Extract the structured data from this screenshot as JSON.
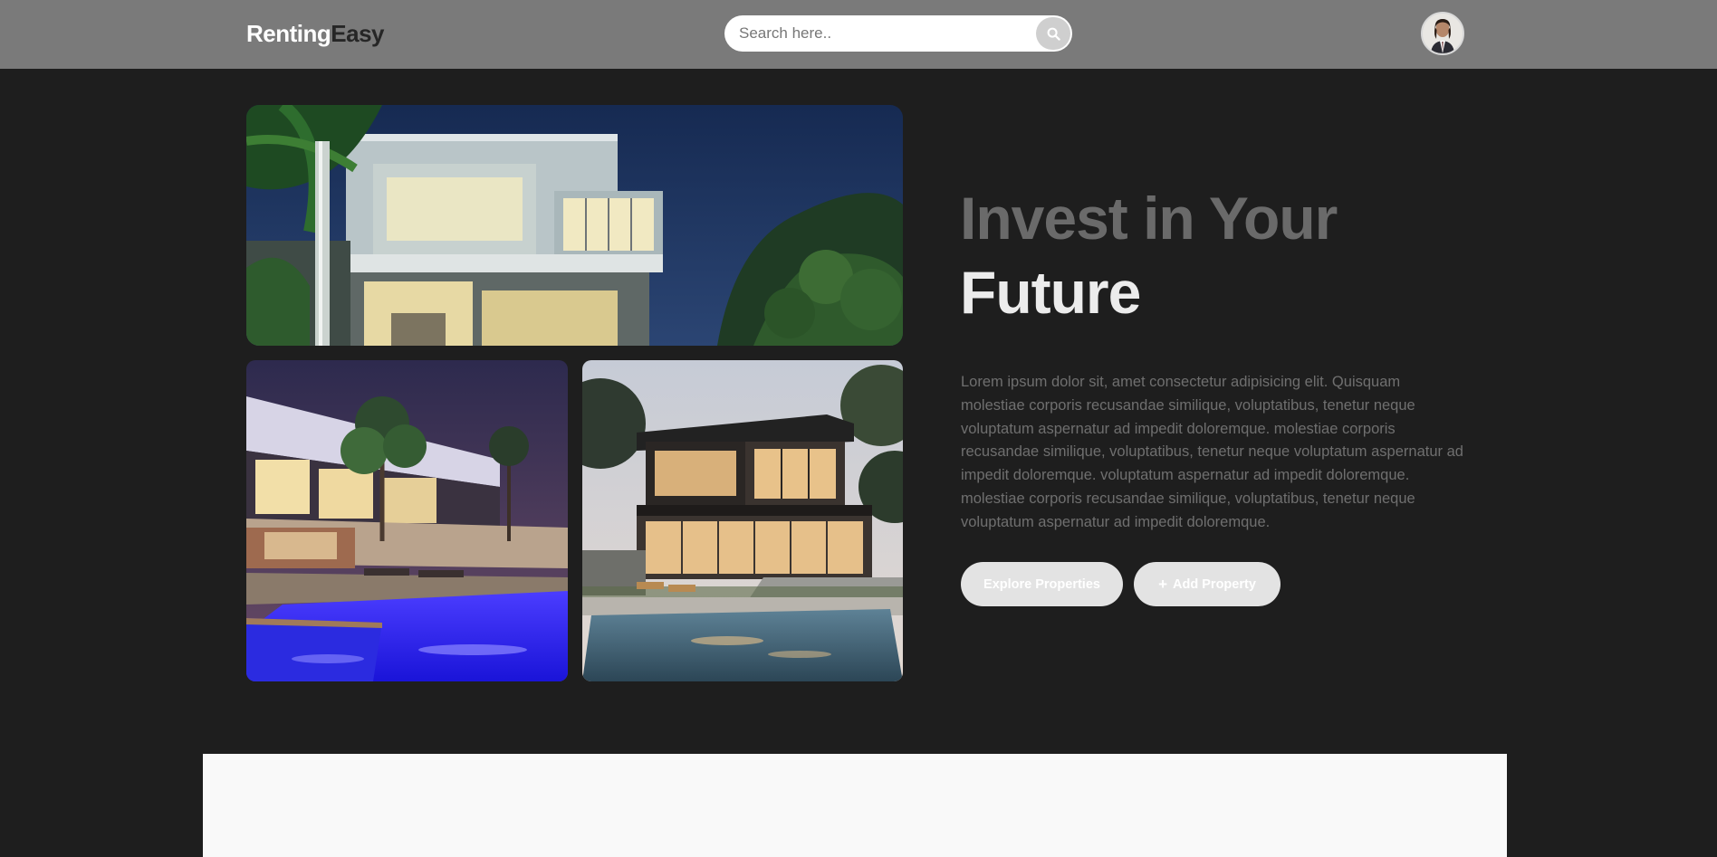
{
  "header": {
    "logo_part1": "Renting",
    "logo_part2": "Easy",
    "search_placeholder": "Search here..",
    "avatar_icon": "user-avatar"
  },
  "hero": {
    "title_line1": "Invest in Your",
    "title_line2": "Future",
    "description": "Lorem ipsum dolor sit, amet consectetur adipisicing elit. Quisquam molestiae corporis recusandae similique, voluptatibus, tenetur neque voluptatum aspernatur ad impedit doloremque. molestiae corporis recusandae similique, voluptatibus, tenetur neque voluptatum aspernatur ad impedit doloremque. voluptatum aspernatur ad impedit doloremque. molestiae corporis recusandae similique, voluptatibus, tenetur neque voluptatum aspernatur ad impedit doloremque.",
    "explore_label": "Explore Properties",
    "add_icon": "+",
    "add_label": "Add Property"
  },
  "colors": {
    "page_bg": "#1e1e1e",
    "header_bg": "#7a7a7a",
    "button_bg": "#e3e3e3",
    "title_muted": "#6a6a6a",
    "title_bright": "#ececec"
  }
}
